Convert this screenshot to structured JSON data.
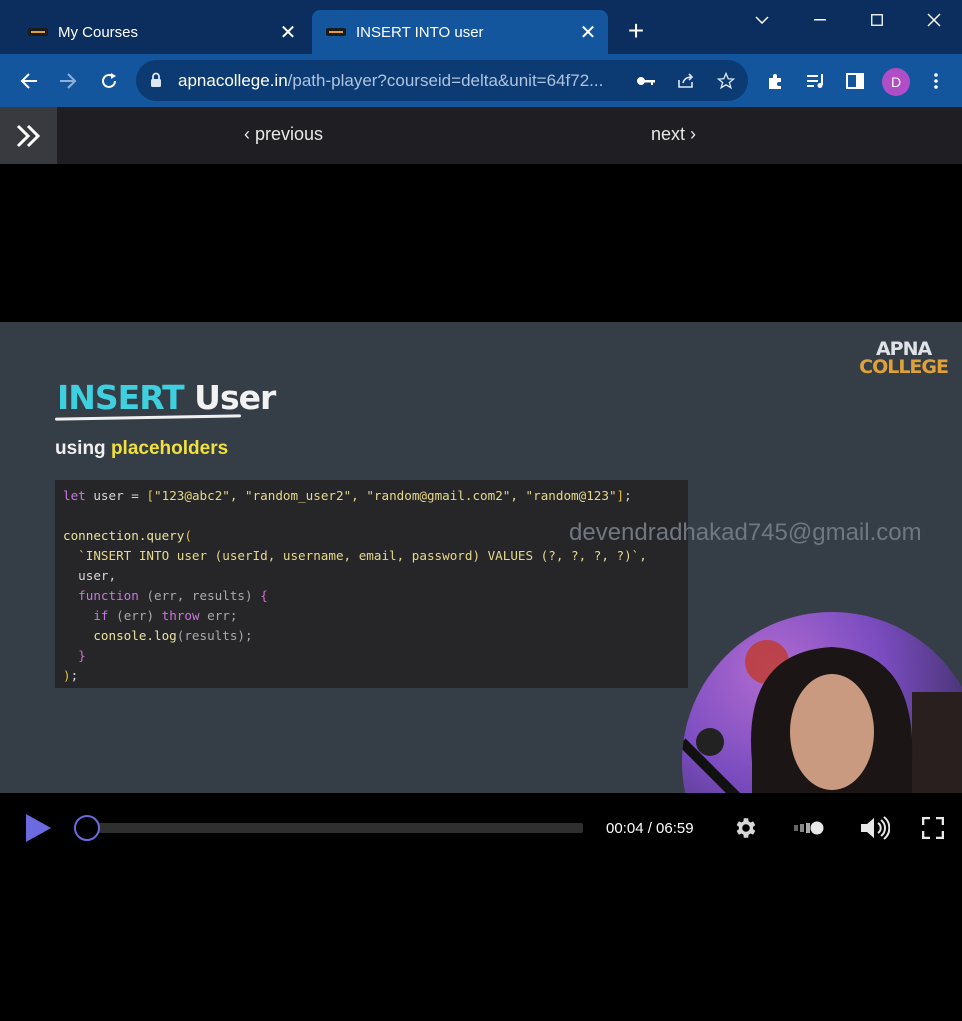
{
  "tabs": [
    {
      "title": "My Courses",
      "favicon": "apna-college-favicon",
      "active": false
    },
    {
      "title": "INSERT INTO user",
      "favicon": "apna-college-favicon",
      "active": true
    }
  ],
  "address": {
    "domain": "apnacollege.in",
    "path": "/path-player?courseid=delta&unit=64f72..."
  },
  "profile_initial": "D",
  "player_nav": {
    "previous": "previous",
    "next": "next"
  },
  "slide": {
    "logo_line1": "APNA",
    "logo_line2": "COLLEGE",
    "title_part1": "INSERT",
    "title_part2": "User",
    "subtitle_part1": "using",
    "subtitle_part2": "placeholders",
    "watermark": "devendradhakad745@gmail.com",
    "code": {
      "line1_kw": "let",
      "line1_var": "user",
      "line1_strings": "\"123@abc2\", \"random_user2\", \"random@gmail.com2\", \"random@123\"",
      "line3": "connection.query",
      "line4": "`INSERT INTO user (userId, username, email, password) VALUES (?, ?, ?, ?)`,",
      "line5": "user,",
      "line6_kw": "function",
      "line6_args": "(err, results)",
      "line7_kw1": "if",
      "line7_arg": "(err)",
      "line7_kw2": "throw",
      "line7_var": "err;",
      "line8": "console.log",
      "line8_arg": "(results);"
    }
  },
  "controls": {
    "time": "00:04 / 06:59",
    "progress": 0.01
  },
  "colors": {
    "tab_bar": "#0b2e5e",
    "active_tab": "#14569e",
    "slide_bg": "#353d47",
    "title_accent": "#3fd0e0",
    "subtitle_accent": "#f1e13a",
    "progress_knob": "#6b6ae0"
  }
}
